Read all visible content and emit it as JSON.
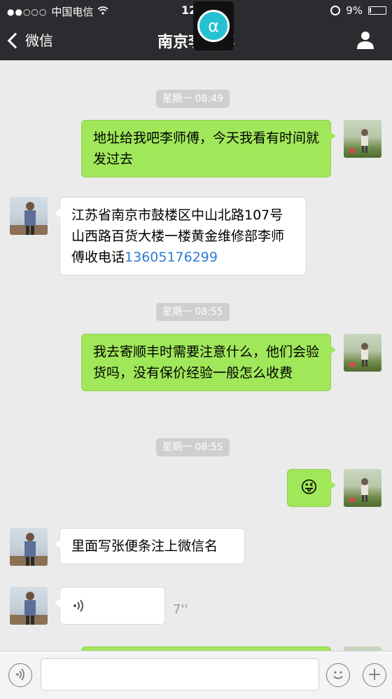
{
  "status_bar": {
    "signal": "●●○○○",
    "carrier": "中国电信",
    "time": "12:03",
    "battery": "9%",
    "battery_level": 0.09
  },
  "nav": {
    "back_label": "微信",
    "title": "南京李师傅",
    "overlay_glyph": "α"
  },
  "messages": [
    {
      "type": "timestamp",
      "text": "星期一 08:49"
    },
    {
      "type": "text",
      "side": "right",
      "text": "地址给我吧李师傅，今天我看有时间就发过去"
    },
    {
      "type": "text",
      "side": "left",
      "text": "江苏省南京市鼓楼区中山北路107号山西路百货大楼一楼黄金维修部李师傅收电话",
      "phone": "13605176299"
    },
    {
      "type": "timestamp",
      "text": "星期一 08:55"
    },
    {
      "type": "text",
      "side": "right",
      "text": "我去寄顺丰时需要注意什么，他们会验货吗，没有保价经验一般怎么收费"
    },
    {
      "type": "timestamp",
      "text": "星期一 08:55"
    },
    {
      "type": "emoji",
      "side": "right",
      "text": "😜"
    },
    {
      "type": "text",
      "side": "left",
      "text": "里面写张便条注上微信名"
    },
    {
      "type": "voice",
      "side": "left",
      "icon": "voice-wave-icon",
      "duration": "7''"
    }
  ],
  "input_bar": {
    "voice_icon": "voice-mode-icon",
    "emoji_icon": "emoji-icon",
    "plus_icon": "plus-icon",
    "input_value": ""
  },
  "colors": {
    "nav_bg": "#2b2c2f",
    "chat_bg": "#ebebeb",
    "bubble_right": "#a0e75a",
    "bubble_left": "#ffffff",
    "link": "#2e7ad6"
  }
}
